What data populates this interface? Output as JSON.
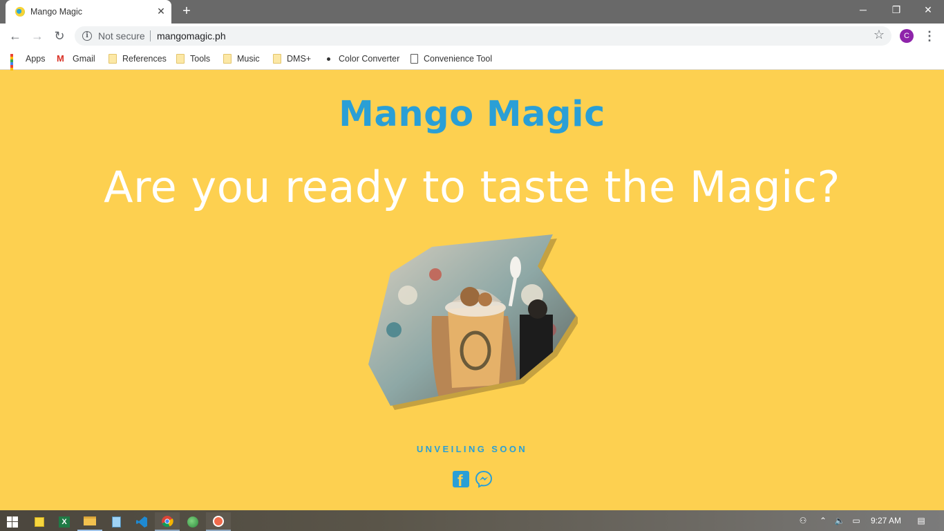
{
  "browser": {
    "tab": {
      "title": "Mango Magic"
    },
    "omnibox": {
      "security_label": "Not secure",
      "url": "mangomagic.ph"
    },
    "profile_initial": "C",
    "bookmarks": [
      {
        "label": "Apps",
        "icon": "apps-grid-icon"
      },
      {
        "label": "Gmail",
        "icon": "gmail-icon"
      },
      {
        "label": "References",
        "icon": "folder-icon"
      },
      {
        "label": "Tools",
        "icon": "folder-icon"
      },
      {
        "label": "Music",
        "icon": "folder-icon"
      },
      {
        "label": "DMS+",
        "icon": "folder-icon"
      },
      {
        "label": "Color Converter",
        "icon": "dot-icon"
      },
      {
        "label": "Convenience Tool",
        "icon": "page-icon"
      }
    ]
  },
  "page": {
    "site_title": "Mango Magic",
    "tagline": "Are you ready to taste the Magic?",
    "hero_image": "mango-dessert-cup-photo",
    "unveiling": "UNVEILING SOON",
    "social": [
      "facebook-icon",
      "messenger-icon"
    ]
  },
  "taskbar": {
    "apps": [
      "windows-start-icon",
      "sticky-notes-icon",
      "excel-icon",
      "file-explorer-icon",
      "notepad-icon",
      "vscode-icon",
      "chrome-icon",
      "globe-app-icon",
      "browser-app-icon"
    ],
    "clock": "9:27 AM"
  },
  "colors": {
    "page_background": "#fdd050",
    "brand_blue": "#2a9fd6",
    "tagline_white": "#ffffff"
  }
}
